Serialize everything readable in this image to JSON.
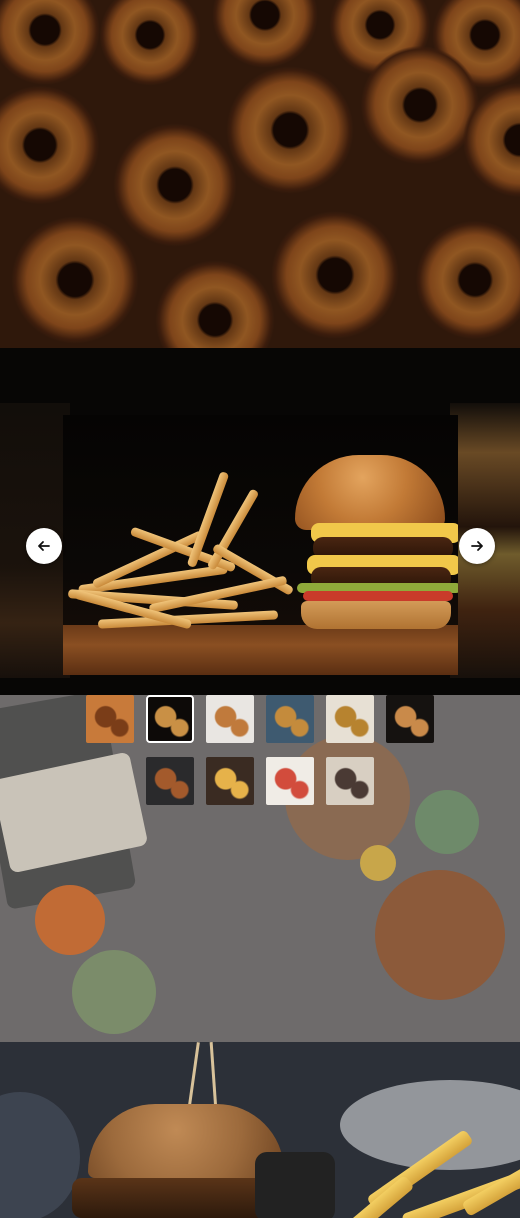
{
  "gallery": {
    "prev_icon": "arrow-left-icon",
    "next_icon": "arrow-right-icon",
    "active_index": 1,
    "thumbnails": [
      {
        "icon": "donuts-thumbnail",
        "colors": [
          "#c87a3a",
          "#7a3d18"
        ]
      },
      {
        "icon": "burger-fries-thumbnail",
        "colors": [
          "#0d0a08",
          "#c99045"
        ]
      },
      {
        "icon": "table-spread-thumbnail",
        "colors": [
          "#e9e6e2",
          "#c07a3c"
        ]
      },
      {
        "icon": "burger-plate-thumbnail",
        "colors": [
          "#3e5a70",
          "#c48b3c"
        ]
      },
      {
        "icon": "breakfast-thumbnail",
        "colors": [
          "#e7e0d4",
          "#b7832f"
        ]
      },
      {
        "icon": "sandwich-thumbnail",
        "colors": [
          "#151210",
          "#c98a4a"
        ]
      },
      {
        "icon": "steak-thumbnail",
        "colors": [
          "#2a2a2c",
          "#a35a2c"
        ]
      },
      {
        "icon": "fries-thumbnail",
        "colors": [
          "#3a2b22",
          "#e6b24a"
        ]
      },
      {
        "icon": "salad-bowls-thumbnail",
        "colors": [
          "#f0ece6",
          "#d24c3c"
        ]
      },
      {
        "icon": "diners-thumbnail",
        "colors": [
          "#d8cfc2",
          "#4a3a34"
        ]
      }
    ]
  },
  "colors": {
    "button_bg": "#ffffff",
    "icon_color": "#111111",
    "active_border": "#ffffff"
  }
}
